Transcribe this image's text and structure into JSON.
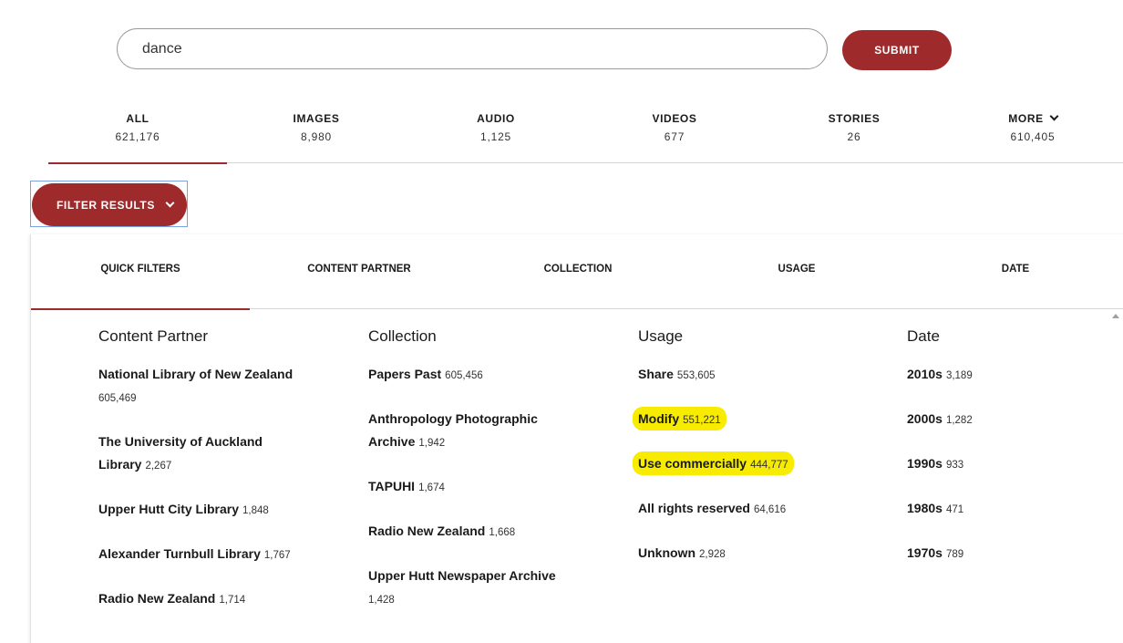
{
  "search": {
    "value": "dance",
    "submit_label": "SUBMIT"
  },
  "tabs": [
    {
      "label": "ALL",
      "count": "621,176"
    },
    {
      "label": "IMAGES",
      "count": "8,980"
    },
    {
      "label": "AUDIO",
      "count": "1,125"
    },
    {
      "label": "VIDEOS",
      "count": "677"
    },
    {
      "label": "STORIES",
      "count": "26"
    },
    {
      "label": "MORE",
      "count": "610,405"
    }
  ],
  "filter_button": {
    "label": "FILTER RESULTS"
  },
  "filter_tabs": [
    "QUICK FILTERS",
    "CONTENT PARTNER",
    "COLLECTION",
    "USAGE",
    "DATE"
  ],
  "columns": [
    {
      "title": "Content Partner",
      "items": [
        {
          "name": "National Library of New Zealand",
          "count": "605,469"
        },
        {
          "name": "The University of Auckland Library",
          "count": "2,267"
        },
        {
          "name": "Upper Hutt City Library",
          "count": "1,848"
        },
        {
          "name": "Alexander Turnbull Library",
          "count": "1,767"
        },
        {
          "name": "Radio New Zealand",
          "count": "1,714"
        }
      ]
    },
    {
      "title": "Collection",
      "items": [
        {
          "name": "Papers Past",
          "count": "605,456"
        },
        {
          "name": "Anthropology Photographic Archive",
          "count": "1,942"
        },
        {
          "name": "TAPUHI",
          "count": "1,674"
        },
        {
          "name": "Radio New Zealand",
          "count": "1,668"
        },
        {
          "name": "Upper Hutt Newspaper Archive",
          "count": "1,428"
        }
      ]
    },
    {
      "title": "Usage",
      "items": [
        {
          "name": "Share",
          "count": "553,605"
        },
        {
          "name": "Modify",
          "count": "551,221"
        },
        {
          "name": "Use commercially",
          "count": "444,777"
        },
        {
          "name": "All rights reserved",
          "count": "64,616"
        },
        {
          "name": "Unknown",
          "count": "2,928"
        }
      ]
    },
    {
      "title": "Date",
      "items": [
        {
          "name": "2010s",
          "count": "3,189"
        },
        {
          "name": "2000s",
          "count": "1,282"
        },
        {
          "name": "1990s",
          "count": "933"
        },
        {
          "name": "1980s",
          "count": "471"
        },
        {
          "name": "1970s",
          "count": "789"
        }
      ]
    }
  ],
  "colors": {
    "accent": "#9e2a2b",
    "highlight": "#f7ec00"
  }
}
